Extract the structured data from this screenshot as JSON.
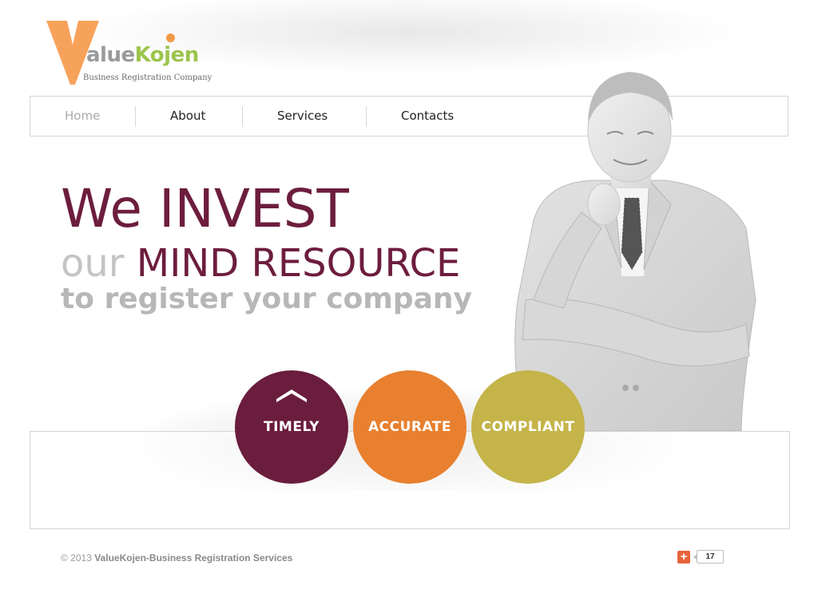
{
  "logo": {
    "letter": "V",
    "word_part1": "alue",
    "word_part2": "Kojen",
    "tagline": "Business Registration Company"
  },
  "nav": {
    "items": [
      {
        "label": "Home",
        "active": true
      },
      {
        "label": "About",
        "active": false
      },
      {
        "label": "Services",
        "active": false
      },
      {
        "label": "Contacts",
        "active": false
      }
    ]
  },
  "hero": {
    "line1": "We INVEST",
    "line2_part1": "our ",
    "line2_part2": "MIND RESOURCE",
    "line3": "to register your company"
  },
  "circles": [
    {
      "label": "TIMELY",
      "color": "#6a1d3c",
      "icon": "chevron-up-icon"
    },
    {
      "label": "ACCURATE",
      "color": "#e8802f"
    },
    {
      "label": "COMPLIANT",
      "color": "#c4b449"
    }
  ],
  "footer": {
    "copyright": "© 2013",
    "site_name": "ValueKojen-Business Registration Services"
  },
  "share": {
    "button_symbol": "+",
    "count": "17",
    "icon": "plus-share-icon"
  },
  "colors": {
    "plum": "#6d1d3d",
    "orange": "#e8802f",
    "olive": "#c4b449",
    "logo_orange": "#f7a25a",
    "logo_green": "#9cc44c"
  }
}
